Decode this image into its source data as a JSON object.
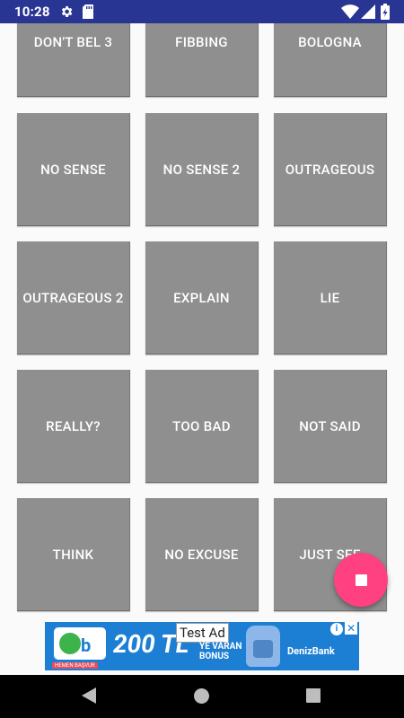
{
  "status_bar": {
    "time": "10:28",
    "icons": [
      "gear-icon",
      "sd-card-icon",
      "wifi-icon",
      "signal-icon",
      "battery-charging-icon"
    ],
    "background": "#283593"
  },
  "grid": {
    "tile_color": "#8f8f8f",
    "rows": [
      [
        "DON'T BEL 3",
        "FIBBING",
        "BOLOGNA"
      ],
      [
        "NO SENSE",
        "NO SENSE 2",
        "OUTRAGEOUS"
      ],
      [
        "OUTRAGEOUS 2",
        "EXPLAIN",
        "LIE"
      ],
      [
        "REALLY?",
        "TOO BAD",
        "NOT SAID"
      ],
      [
        "THINK",
        "NO EXCUSE",
        "JUST SEE"
      ]
    ]
  },
  "fab": {
    "icon": "stop-icon",
    "color": "#ff4081"
  },
  "ad": {
    "label": "Test Ad",
    "amount": "200 TL",
    "sub1": "YE VARAN",
    "sub2": "BONUS",
    "apply": "HEMEN BAŞVUR",
    "brand": "DenizBank",
    "info_icon": "info-icon",
    "close_icon": "close-icon",
    "background": "#1d7fd3"
  },
  "nav_bar": {
    "icons": [
      "back-icon",
      "home-icon",
      "recents-icon"
    ]
  }
}
